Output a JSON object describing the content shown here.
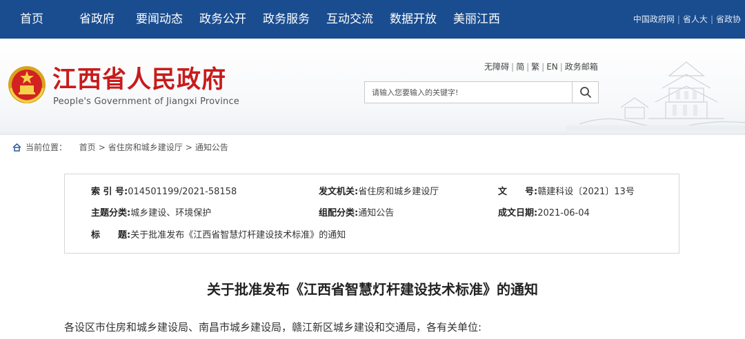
{
  "topnav": {
    "items": [
      "首页",
      "省政府",
      "要闻动态",
      "政务公开",
      "政务服务",
      "互动交流",
      "数据开放",
      "美丽江西"
    ],
    "links": [
      "中国政府网",
      "省人大",
      "省政协"
    ]
  },
  "header": {
    "site_name_cn": "江西省人民政府",
    "site_name_en": "People's Government of Jiangxi Province",
    "tools": [
      "无障碍",
      "简",
      "繁",
      "EN",
      "政务邮箱"
    ],
    "search_placeholder": "请输入您要输入的关键字!"
  },
  "breadcrumb": {
    "label": "当前位置：",
    "items": [
      "首页",
      "省住房和城乡建设厅",
      "通知公告"
    ]
  },
  "info": {
    "index_label": "索 引 号:",
    "index_value": "014501199/2021-58158",
    "issuer_label": "发文机关:",
    "issuer_value": "省住房和城乡建设厅",
    "docno_label": "文　　号:",
    "docno_value": "赣建科设〔2021〕13号",
    "topic_label": "主题分类:",
    "topic_value": "城乡建设、环境保护",
    "category_label": "组配分类:",
    "category_value": "通知公告",
    "date_label": "成文日期:",
    "date_value": "2021-06-04",
    "title_label": "标　　题:",
    "title_value": "关于批准发布《江西省智慧灯杆建设技术标准》的通知"
  },
  "article": {
    "title": "关于批准发布《江西省智慧灯杆建设技术标准》的通知",
    "first_line": "各设区市住房和城乡建设局、南昌市城乡建设局，赣江新区城乡建设和交通局，各有关单位:"
  },
  "colors": {
    "nav_bg": "#1a4d8f",
    "logo_red": "#c81b1b"
  }
}
